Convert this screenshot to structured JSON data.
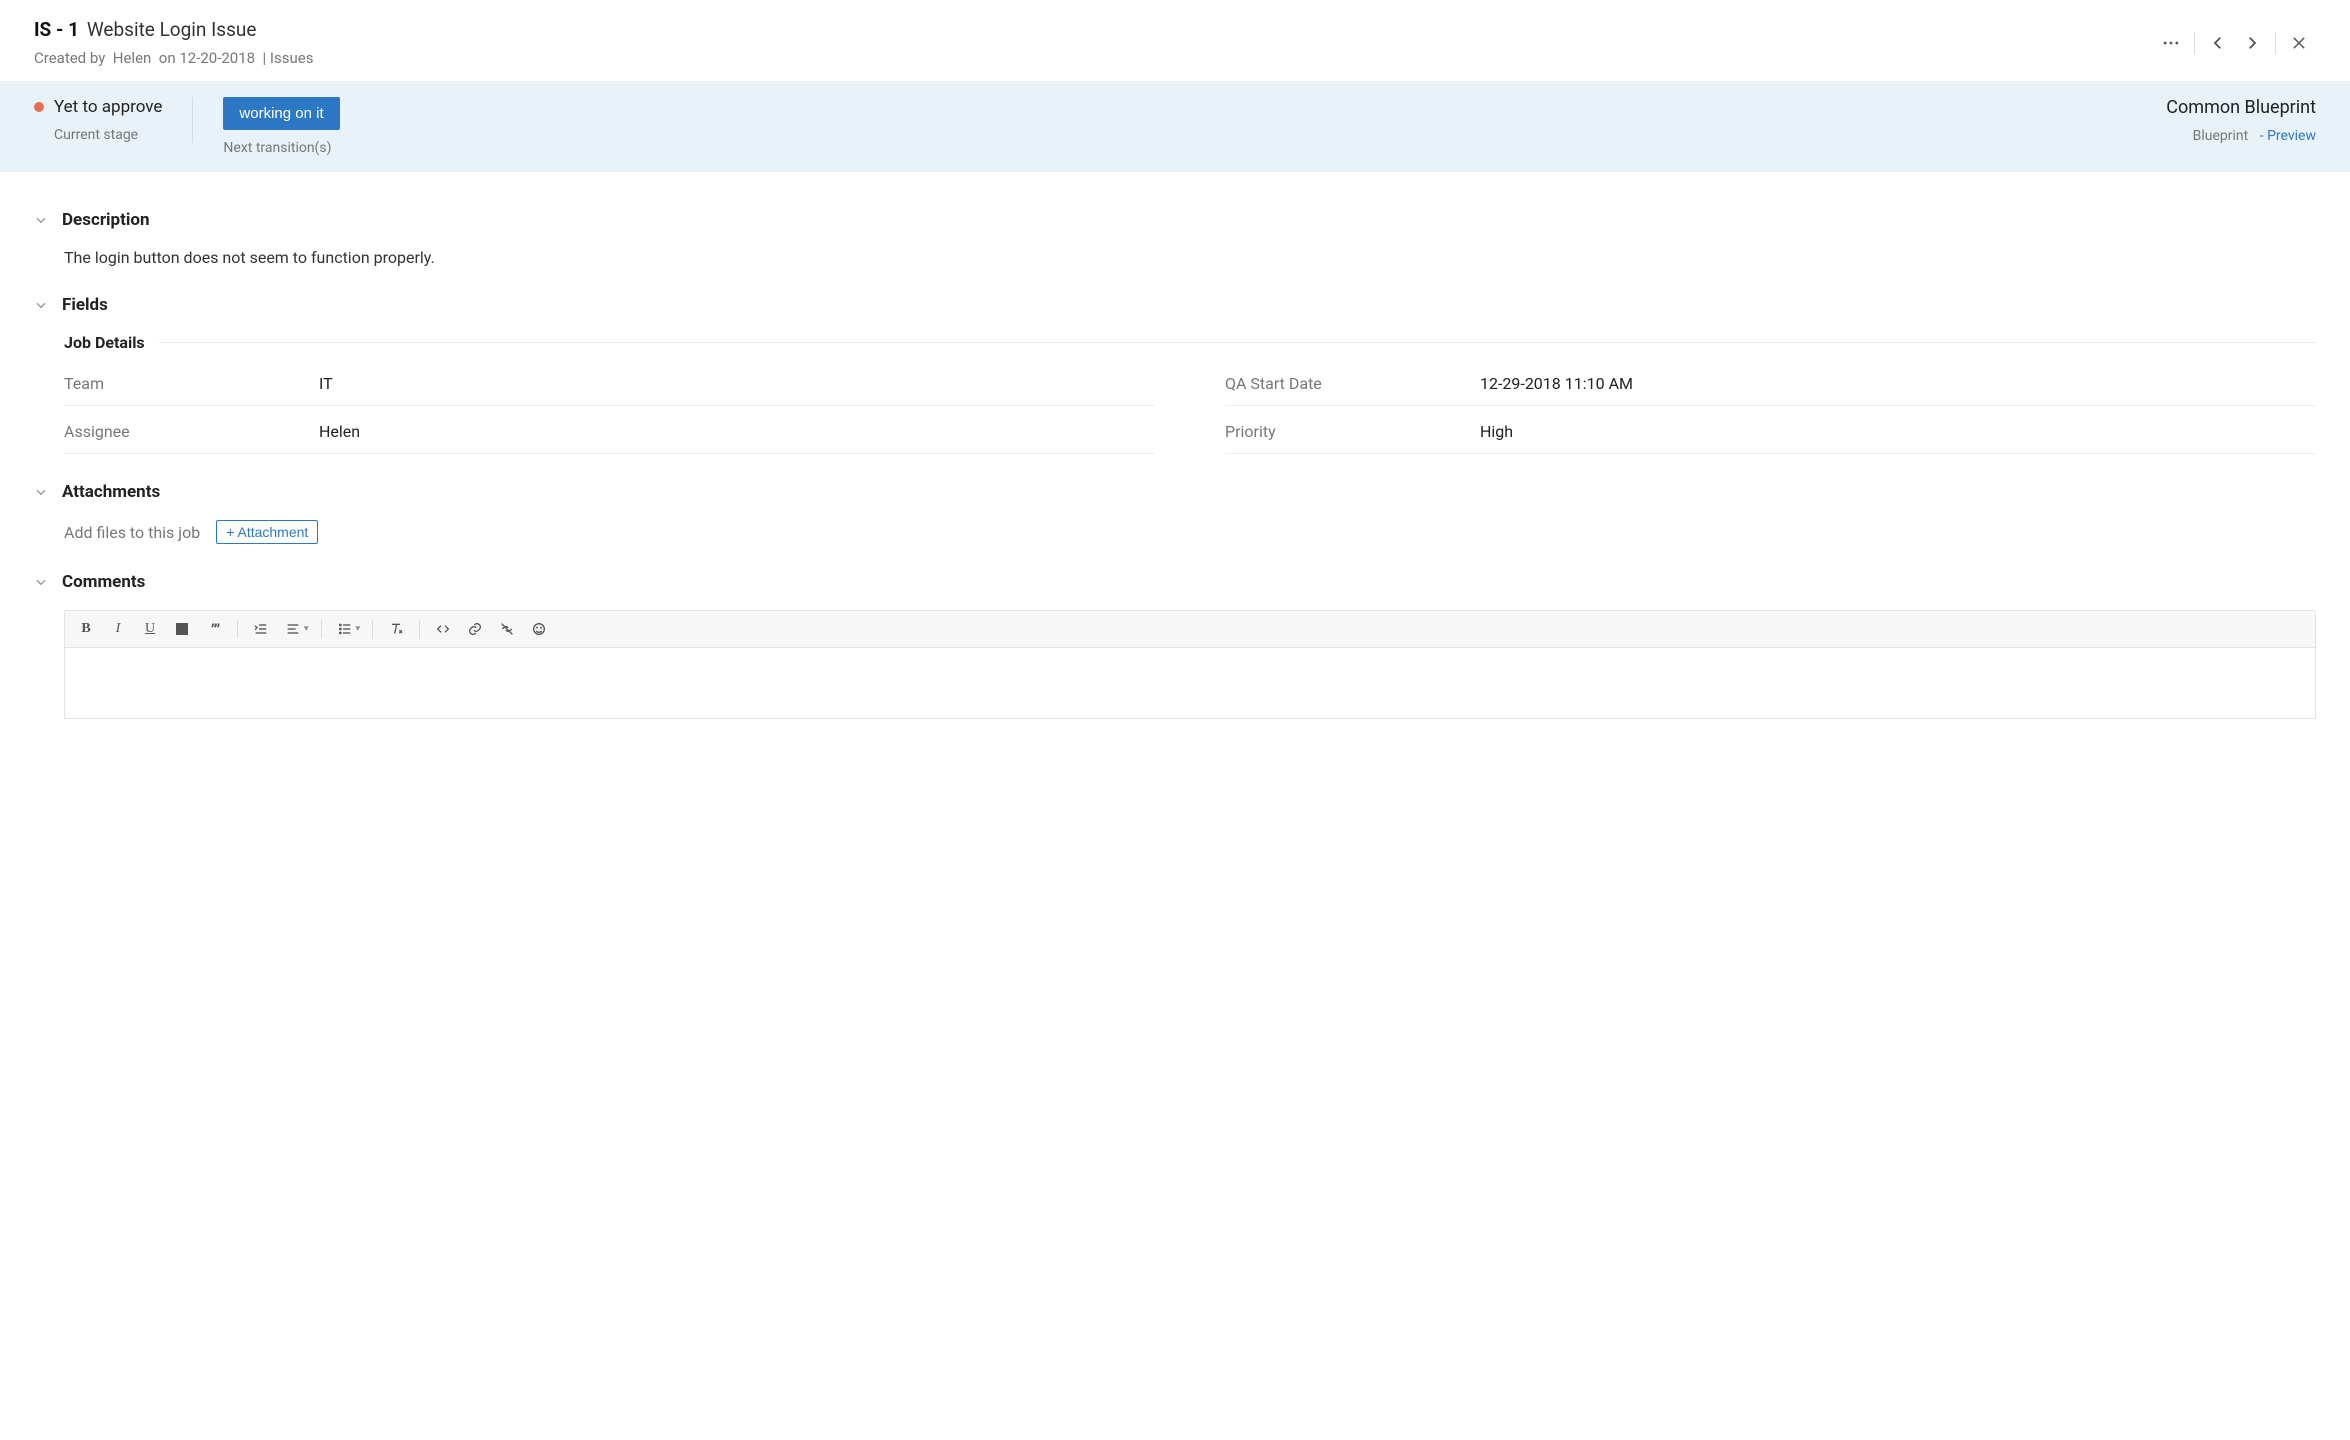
{
  "header": {
    "issue_key": "IS - 1",
    "issue_title": "Website Login Issue",
    "created_by_label": "Created by",
    "created_by_user": "Helen",
    "created_on_label": "on",
    "created_on_date": "12-20-2018",
    "breadcrumb": "Issues"
  },
  "stage": {
    "current_stage": "Yet to approve",
    "current_stage_label": "Current stage",
    "transition_button": "working on it",
    "next_transitions_label": "Next transition(s)",
    "blueprint_name": "Common Blueprint",
    "blueprint_label": "Blueprint",
    "preview_link": "- Preview"
  },
  "sections": {
    "description": {
      "title": "Description",
      "text": "The login button does not seem to function properly."
    },
    "fields": {
      "title": "Fields",
      "subhead": "Job Details",
      "left": [
        {
          "label": "Team",
          "value": "IT"
        },
        {
          "label": "Assignee",
          "value": "Helen"
        }
      ],
      "right": [
        {
          "label": "QA Start Date",
          "value": "12-29-2018 11:10 AM"
        },
        {
          "label": "Priority",
          "value": "High"
        }
      ]
    },
    "attachments": {
      "title": "Attachments",
      "hint": "Add files to this job",
      "button": "+ Attachment"
    },
    "comments": {
      "title": "Comments"
    }
  }
}
